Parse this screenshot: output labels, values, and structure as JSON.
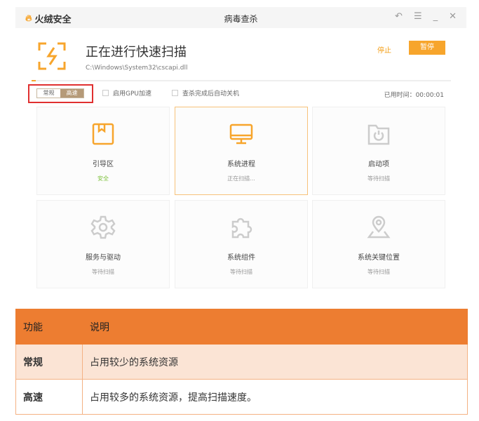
{
  "app": {
    "name": "火绒安全",
    "title": "病毒查杀",
    "window_controls": [
      "restore-icon",
      "menu-icon",
      "minimize-icon",
      "close-icon"
    ]
  },
  "scan": {
    "heading": "正在进行快速扫描",
    "current_file": "C:\\Windows\\System32\\cscapi.dll",
    "stop_label": "停止",
    "pause_label": "暂停",
    "progress_percent": 1
  },
  "options": {
    "mode_normal": "常规",
    "mode_fast": "高速",
    "selected_mode": "高速",
    "gpu_label": "启用GPU加速",
    "shutdown_label": "查杀完成后自动关机",
    "elapsed_label": "已用时间：00:00:01"
  },
  "cards": [
    {
      "name": "引导区",
      "status": "安全",
      "icon": "bookmark-box-icon"
    },
    {
      "name": "系统进程",
      "status": "正在扫描...",
      "icon": "monitor-icon"
    },
    {
      "name": "启动项",
      "status": "等待扫描",
      "icon": "power-folder-icon"
    },
    {
      "name": "服务与驱动",
      "status": "等待扫描",
      "icon": "gear-icon"
    },
    {
      "name": "系统组件",
      "status": "等待扫描",
      "icon": "puzzle-icon"
    },
    {
      "name": "系统关键位置",
      "status": "等待扫描",
      "icon": "map-pin-icon"
    }
  ],
  "table": {
    "headers": [
      "功能",
      "说明"
    ],
    "rows": [
      [
        "常规",
        "占用较少的系统资源"
      ],
      [
        "高速",
        "占用较多的系统资源，提高扫描速度。"
      ]
    ]
  },
  "colors": {
    "accent": "#f7a52c",
    "header": "#ed7d31",
    "safe": "#7cc13a"
  }
}
